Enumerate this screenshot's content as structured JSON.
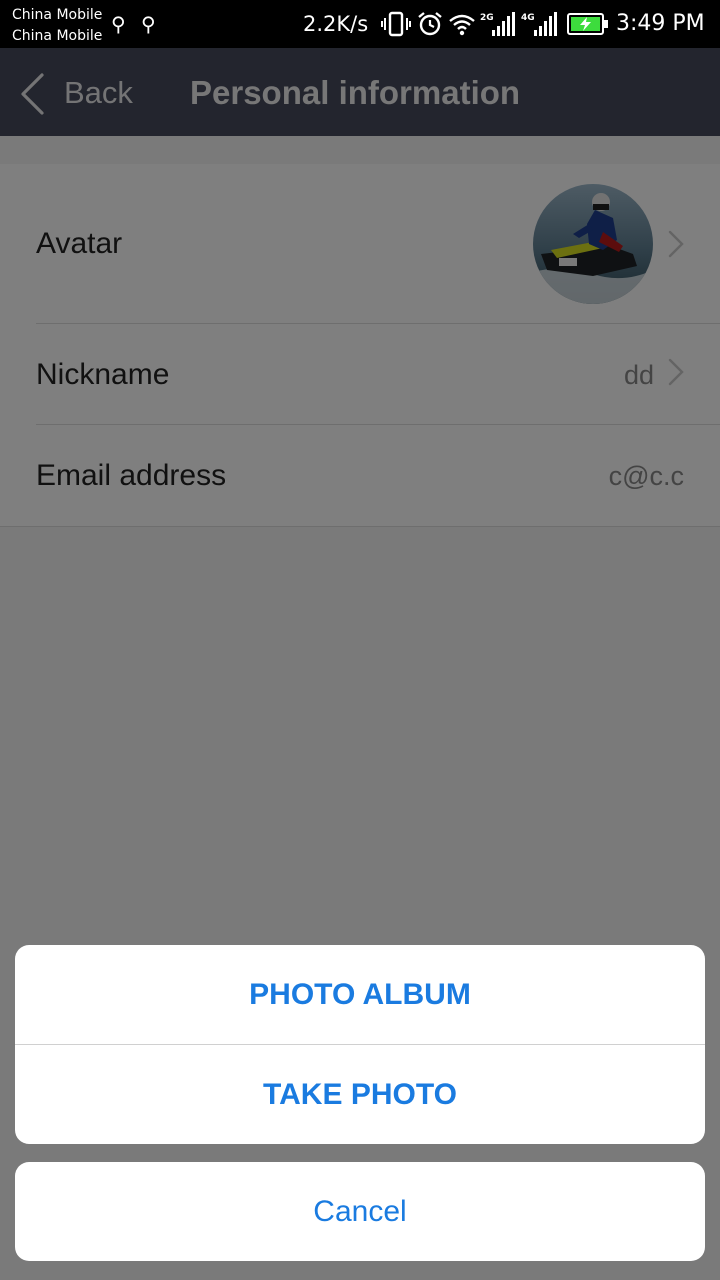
{
  "status_bar": {
    "carrier_1": "China Mobile",
    "carrier_2": "China Mobile",
    "net_speed": "2.2K/s",
    "sim1_network": "2G",
    "sim2_network": "4G",
    "time": "3:49 PM",
    "icons": [
      "usb-icon",
      "usb-icon",
      "vibrate-icon",
      "alarm-icon",
      "wifi-icon",
      "signal-icon",
      "signal-icon",
      "battery-charging-icon"
    ]
  },
  "nav": {
    "back_label": "Back",
    "title": "Personal information"
  },
  "profile": {
    "avatar_label": "Avatar",
    "nickname_label": "Nickname",
    "nickname_value": "dd",
    "email_label": "Email address",
    "email_value": "c@c.c"
  },
  "action_sheet": {
    "photo_album_label": "PHOTO ALBUM",
    "take_photo_label": "TAKE PHOTO",
    "cancel_label": "Cancel"
  },
  "colors": {
    "status_bar_bg": "#000000",
    "nav_bg": "#474b5c",
    "action_text": "#1a7be0",
    "battery_fill": "#3ddc3d",
    "dim_overlay": "rgba(0,0,0,0.5)"
  }
}
